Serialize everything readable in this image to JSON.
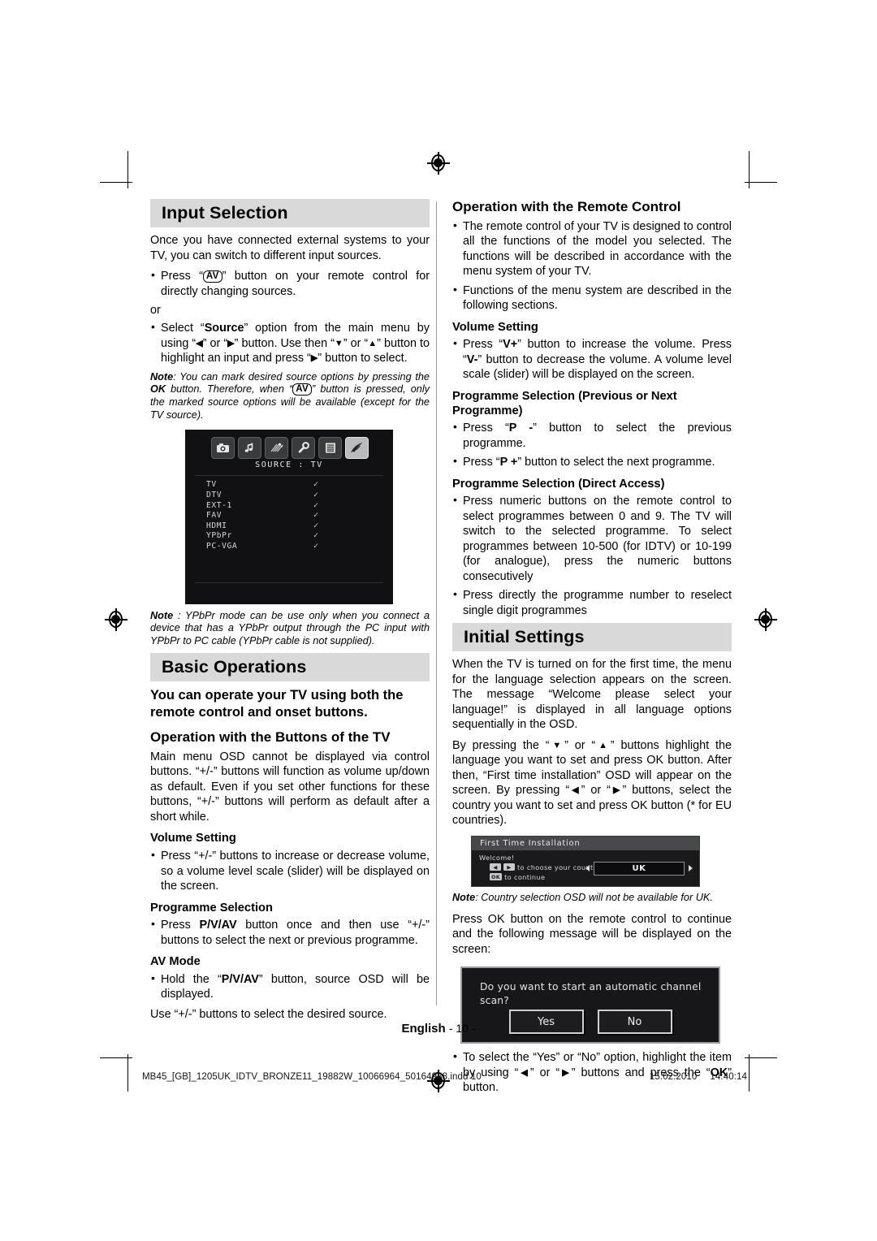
{
  "page": {
    "language_footer": "English",
    "page_number": "- 10 -",
    "file_meta": "MB45_[GB]_1205UK_IDTV_BRONZE11_19882W_10066964_50164988.indd   10",
    "date": "15.02.2010",
    "time": "14:40:14",
    "band_color": "#d9d9d9"
  },
  "left_column": {
    "input_selection": {
      "heading": "Input Selection",
      "intro": "Once you have connected external systems to your TV, you can switch to different input sources.",
      "bullet1_pre": "Press “",
      "bullet1_key": "AV",
      "bullet1_post": "” button on your remote control for directly changing sources.",
      "or_text": "or",
      "bullet2_a": "Select “",
      "bullet2_source": "Source",
      "bullet2_b": "” option from the main menu by using “",
      "bullet2_left": "◀",
      "bullet2_c": "” or “",
      "bullet2_right": "▶",
      "bullet2_d": "” button. Use then “",
      "bullet2_down": "▼",
      "bullet2_e": "” or “",
      "bullet2_up": "▲",
      "bullet2_f": "” button to highlight an input and press “",
      "bullet2_g": "” button to select.",
      "note_label": "Note",
      "note_a": ": You can mark desired source options by pressing the ",
      "note_ok": "OK",
      "note_b": " button. Therefore, when “",
      "note_key": "AV",
      "note_c": "” button is pressed, only the marked source options will be available (except for the TV source)."
    },
    "source_osd": {
      "title": "SOURCE  :  TV",
      "icons": [
        "picture-icon",
        "sound-icon",
        "feature-icon",
        "settings-icon",
        "list-icon",
        "source-icon"
      ],
      "selected_icon_index": 5,
      "rows": [
        {
          "name": "TV",
          "mark": "✓"
        },
        {
          "name": "DTV",
          "mark": "✓"
        },
        {
          "name": "EXT-1",
          "mark": "✓"
        },
        {
          "name": "FAV",
          "mark": "✓"
        },
        {
          "name": "HDMI",
          "mark": "✓"
        },
        {
          "name": "YPbPr",
          "mark": "✓"
        },
        {
          "name": "PC-VGA",
          "mark": "✓"
        }
      ]
    },
    "ypbpr_note": {
      "label": "Note",
      "text": " : YPbPr mode can be use only when you connect a device that has a YPbPr output through the PC input with YPbPr to PC cable (YPbPr cable is not supplied)."
    },
    "basic_operations": {
      "heading": "Basic Operations",
      "lead": "You can operate your TV using both the remote control and onset buttons.",
      "sub_buttons": "Operation with the Buttons of the TV",
      "buttons_para": "Main menu OSD cannot be displayed via control buttons. “+/-” buttons will function as volume up/down as default. Even if you set other functions for these buttons, “+/-” buttons will perform as default after a short while.",
      "volume_heading": "Volume Setting",
      "volume_bullet": "Press “+/-” buttons to increase or decrease volume, so a volume level scale (slider) will be displayed on the screen.",
      "programme_heading": "Programme Selection",
      "programme_bullet_a": "Press ",
      "programme_bullet_key": "P/V/AV",
      "programme_bullet_b": " button once and then use “+/-” buttons to select the next or previous programme.",
      "av_heading": "AV Mode",
      "av_bullet_a": "Hold the “",
      "av_bullet_key": "P/V/AV",
      "av_bullet_b": "” button, source OSD will be displayed.",
      "av_tail": "Use “+/-” buttons to select the desired source."
    }
  },
  "right_column": {
    "remote_control": {
      "heading": "Operation with the Remote Control",
      "bullet1": "The remote control of your TV is designed to control all the functions of the model you selected. The functions will be described in accordance with the menu system of your TV.",
      "bullet2": "Functions of the menu system are described in the following sections.",
      "volume_heading": "Volume Setting",
      "volume_a": "Press “",
      "volume_vplus": "V+",
      "volume_b": "” button to increase the volume. Press “",
      "volume_vminus": "V-",
      "volume_c": "” button to decrease the volume. A volume level scale (slider) will be displayed on the screen.",
      "prev_next_heading": "Programme Selection (Previous or Next Programme)",
      "prev_a": "Press “",
      "prev_key": "P -",
      "prev_b": "” button to select the previous programme.",
      "next_a": "Press “",
      "next_key": "P +",
      "next_b": "” button to select the next programme.",
      "direct_heading": "Programme Selection (Direct Access)",
      "direct_bullet1": "Press numeric buttons on the remote control to select programmes between 0 and 9. The TV will switch to the selected programme. To select programmes between 10-500 (for IDTV) or 10-199 (for analogue), press the numeric buttons consecutively",
      "direct_bullet2": "Press directly the programme number to reselect single digit programmes"
    },
    "initial_settings": {
      "heading": "Initial Settings",
      "para1": "When the TV is turned on for the first time, the menu for the language selection appears on the screen. The message “Welcome please select your language!” is displayed in all language options sequentially in the OSD.",
      "para2_a": "By pressing the “",
      "para2_down": "▼",
      "para2_b": "” or “",
      "para2_up": "▲",
      "para2_c": "” buttons highlight the language you want to set and press OK button. After then, “First time installation” OSD will appear on the screen. By pressing “",
      "para2_left": "◀",
      "para2_d": "” or “",
      "para2_right": "▶",
      "para2_e": "” buttons, select the country you want to set and press OK button (* for EU countries)."
    },
    "fti_osd": {
      "title": "First Time Installation",
      "welcome": "Welcome!",
      "line1_key_left": "◀",
      "line1_key_right": "▶",
      "line1_text": "to choose your country",
      "line2_key": "OK",
      "line2_text": "to continue",
      "country_value": "UK"
    },
    "fti_note": {
      "label": "Note",
      "text": ": Country selection OSD will not be available for UK."
    },
    "press_ok_para": "Press OK button on the remote control to continue and the following message will be displayed on the screen:",
    "scan_osd": {
      "message": "Do you want to start an automatic channel scan?",
      "yes_label": "Yes",
      "no_label": "No"
    },
    "final_bullet_a": "To select the “Yes” or “No” option, highlight the item by using “",
    "final_left": "◀",
    "final_b": "” or “",
    "final_right": "▶",
    "final_c": "” buttons and press the “",
    "final_ok": "OK",
    "final_d": "” button."
  }
}
